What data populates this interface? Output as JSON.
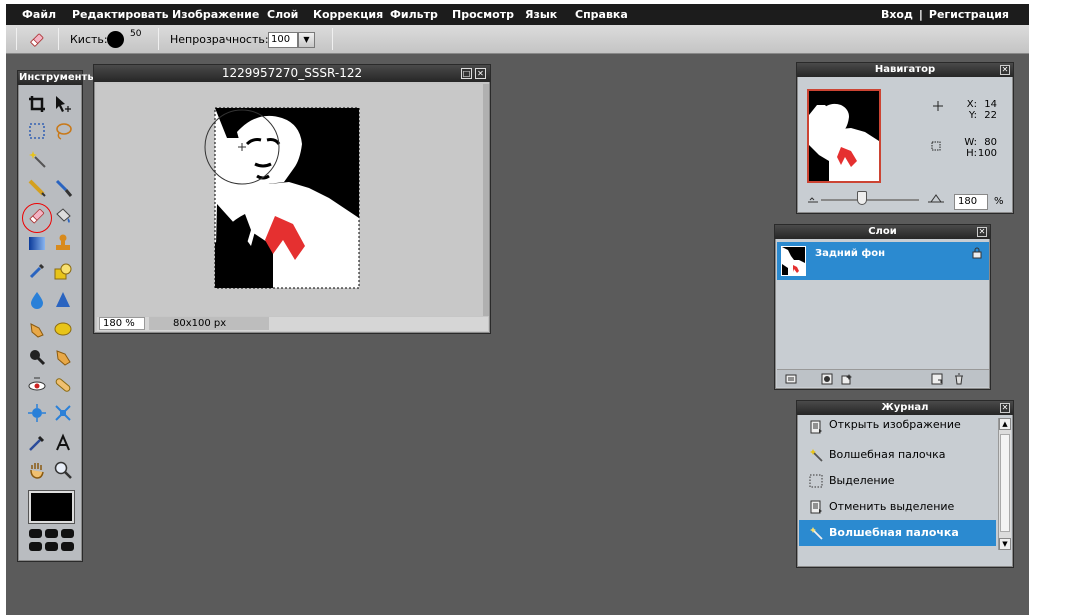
{
  "menu": {
    "items": [
      "Файл",
      "Редактировать",
      "Изображение",
      "Слой",
      "Коррекция",
      "Фильтр",
      "Просмотр",
      "Язык",
      "Справка"
    ],
    "login": "Вход",
    "separator": "|",
    "register": "Регистрация"
  },
  "options": {
    "brush_label": "Кисть:",
    "brush_size": "50",
    "opacity_label": "Непрозрачность:",
    "opacity_value": "100"
  },
  "tools": {
    "title": "Инструменты",
    "active_tool": "eraser-tool",
    "primary_color": "#000000"
  },
  "image_window": {
    "title": "1229957270_SSSR-122",
    "zoom": "180 %",
    "size": "80x100 px"
  },
  "navigator": {
    "title": "Навигатор",
    "x_label": "X:",
    "x_value": "14",
    "y_label": "Y:",
    "y_value": "22",
    "w_label": "W:",
    "w_value": "80",
    "h_label": "H:",
    "h_value": "100",
    "zoom_value": "180",
    "zoom_unit": "%"
  },
  "layers": {
    "title": "Слои",
    "items": [
      {
        "name": "Задний фон",
        "locked": true,
        "selected": true
      }
    ]
  },
  "history": {
    "title": "Журнал",
    "items": [
      {
        "label": "Открыть изображение",
        "icon": "document-icon"
      },
      {
        "label": "Волшебная палочка",
        "icon": "magic-wand-icon"
      },
      {
        "label": "Выделение",
        "icon": "marquee-icon"
      },
      {
        "label": "Отменить выделение",
        "icon": "document-icon"
      },
      {
        "label": "Волшебная палочка",
        "icon": "magic-wand-icon",
        "selected": true
      }
    ]
  },
  "colors": {
    "selection_blue": "#2b8ad0",
    "accent_red": "#e53030",
    "workspace": "#5b5b5b"
  }
}
